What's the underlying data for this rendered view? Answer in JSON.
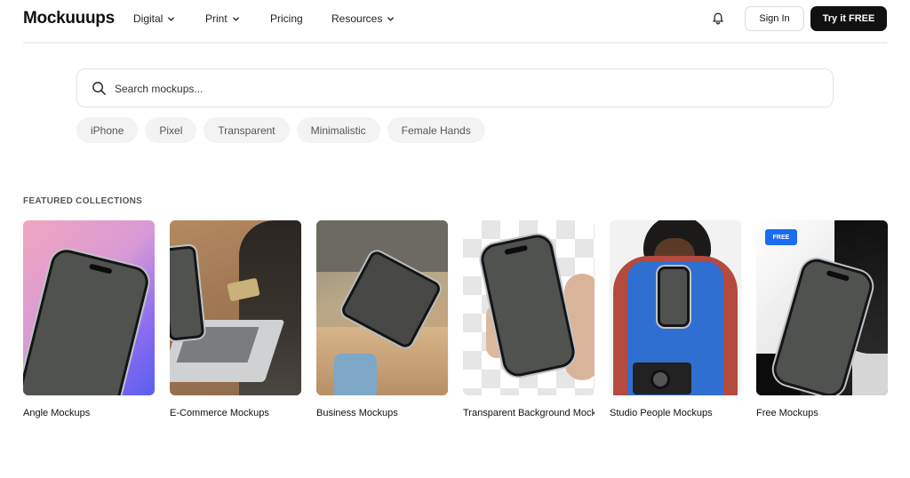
{
  "header": {
    "logo": "Mockuuups",
    "menu": [
      {
        "label": "Digital",
        "has_dropdown": true
      },
      {
        "label": "Print",
        "has_dropdown": true
      },
      {
        "label": "Pricing",
        "has_dropdown": false
      },
      {
        "label": "Resources",
        "has_dropdown": true
      }
    ],
    "notification_icon": "bell-icon",
    "sign_in_label": "Sign In",
    "try_label": "Try it FREE"
  },
  "search": {
    "placeholder": "Search mockups...",
    "value": "",
    "icon": "search-icon"
  },
  "tags": [
    "iPhone",
    "Pixel",
    "Transparent",
    "Minimalistic",
    "Female Hands"
  ],
  "featured": {
    "title": "FEATURED COLLECTIONS",
    "collections": [
      {
        "label": "Angle Mockups"
      },
      {
        "label": "E-Commerce Mockups"
      },
      {
        "label": "Business Mockups"
      },
      {
        "label": "Transparent Background Mockups"
      },
      {
        "label": "Studio People Mockups"
      },
      {
        "label": "Free Mockups",
        "badge": "FREE"
      }
    ]
  },
  "colors": {
    "primary_button": "#111111",
    "free_badge": "#1a6cf0",
    "tag_background": "#f3f3f3"
  }
}
